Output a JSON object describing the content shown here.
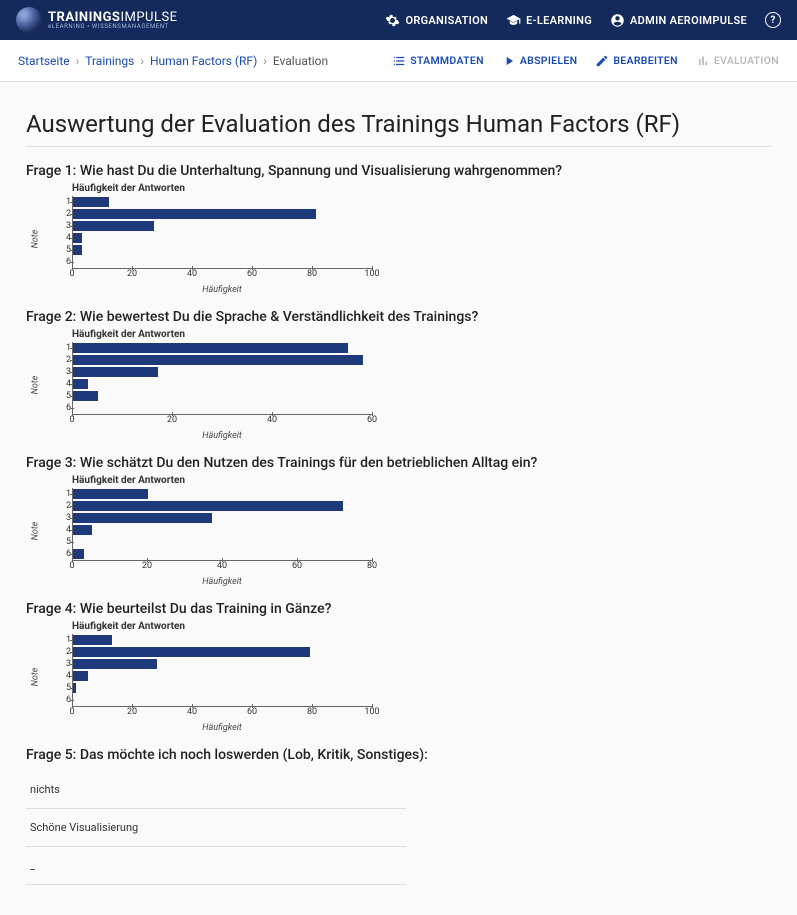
{
  "brand": {
    "line1a": "TRAININGS",
    "line1b": "IMPULSE",
    "line2": "eLEARNING • WISSENSMANAGEMENT"
  },
  "topnav": {
    "organisation": "ORGANISATION",
    "elearning": "E-LEARNING",
    "user": "ADMIN AEROIMPULSE"
  },
  "breadcrumb": {
    "home": "Startseite",
    "trainings": "Trainings",
    "training": "Human Factors (RF)",
    "current": "Evaluation"
  },
  "actions": {
    "stammdaten": "STAMMDATEN",
    "abspielen": "ABSPIELEN",
    "bearbeiten": "BEARBEITEN",
    "evaluation": "EVALUATION"
  },
  "page_title": "Auswertung der Evaluation des Trainings Human Factors (RF)",
  "questions": [
    "Frage 1: Wie hast Du die Unterhaltung, Spannung und Visualisierung wahrgenommen?",
    "Frage 2: Wie bewertest Du die Sprache & Verständlichkeit des Trainings?",
    "Frage 3: Wie schätzt Du den Nutzen des Trainings für den betrieblichen Alltag ein?",
    "Frage 4: Wie beurteilst Du das Training in Gänze?",
    "Frage 5: Das möchte ich noch loswerden (Lob, Kritik, Sonstiges):"
  ],
  "chart_common": {
    "title": "Häufigkeit der Antworten",
    "ylabel": "Note",
    "xlabel": "Häufigkeit",
    "categories": [
      "1",
      "2",
      "3",
      "4",
      "5",
      "6"
    ]
  },
  "chart_data": [
    {
      "type": "bar",
      "categories": [
        "1",
        "2",
        "3",
        "4",
        "5",
        "6"
      ],
      "values": [
        12,
        81,
        27,
        3,
        3,
        0
      ],
      "xticks": [
        0,
        20,
        40,
        60,
        80,
        100
      ],
      "xlim": 100,
      "title": "Häufigkeit der Antworten",
      "ylabel": "Note",
      "xlabel": "Häufigkeit"
    },
    {
      "type": "bar",
      "categories": [
        "1",
        "2",
        "3",
        "4",
        "5",
        "6"
      ],
      "values": [
        55,
        58,
        17,
        3,
        5,
        0
      ],
      "xticks": [
        0,
        20,
        40,
        60
      ],
      "xlim": 60,
      "title": "Häufigkeit der Antworten",
      "ylabel": "Note",
      "xlabel": "Häufigkeit"
    },
    {
      "type": "bar",
      "categories": [
        "1",
        "2",
        "3",
        "4",
        "5",
        "6"
      ],
      "values": [
        20,
        72,
        37,
        5,
        0,
        3
      ],
      "xticks": [
        0,
        20,
        40,
        60,
        80
      ],
      "xlim": 80,
      "title": "Häufigkeit der Antworten",
      "ylabel": "Note",
      "xlabel": "Häufigkeit"
    },
    {
      "type": "bar",
      "categories": [
        "1",
        "2",
        "3",
        "4",
        "5",
        "6"
      ],
      "values": [
        13,
        79,
        28,
        5,
        1,
        0
      ],
      "xticks": [
        0,
        20,
        40,
        60,
        80,
        100
      ],
      "xlim": 100,
      "title": "Häufigkeit der Antworten",
      "ylabel": "Note",
      "xlabel": "Häufigkeit"
    }
  ],
  "freetext_answers": [
    "nichts",
    "Schöne Visualisierung",
    "_"
  ]
}
